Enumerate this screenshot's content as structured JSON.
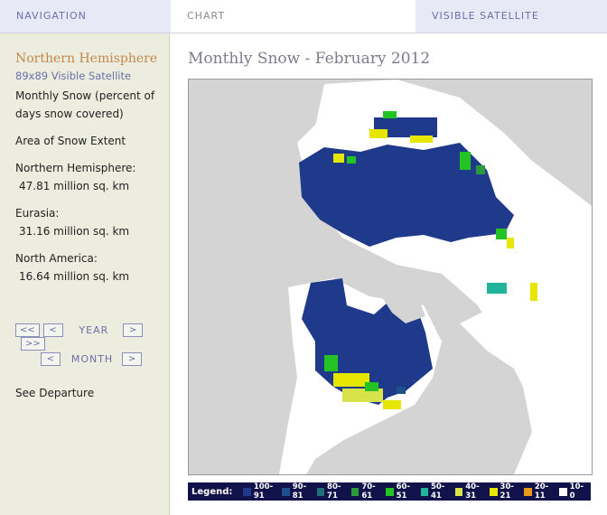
{
  "tabs": {
    "navigation": "NAVIGATION",
    "chart": "CHART",
    "visible_satellite": "VISIBLE SATELLITE"
  },
  "sidebar": {
    "title": "Northern Hemisphere",
    "subtitle": "89x89 Visible Satellite",
    "product": "Monthly Snow (percent of days snow covered)",
    "area_heading": "Area of Snow Extent",
    "nh_label": "Northern Hemisphere:",
    "nh_value": "47.81 million sq. km",
    "eu_label": "Eurasia:",
    "eu_value": "31.16 million sq. km",
    "na_label": "North America:",
    "na_value": "16.64 million sq. km",
    "year_label": "YEAR",
    "month_label": "MONTH",
    "first": "<<",
    "prev": "<",
    "next": ">",
    "last": ">>",
    "see_departure": "See Departure"
  },
  "main": {
    "title": "Monthly Snow - February 2012"
  },
  "legend": {
    "title": "Legend:",
    "items": [
      {
        "label": "100-91",
        "color": "#1f3a8a"
      },
      {
        "label": "90-81",
        "color": "#1e4f8c"
      },
      {
        "label": "80-71",
        "color": "#1f6f78"
      },
      {
        "label": "70-61",
        "color": "#2a9a3a"
      },
      {
        "label": "60-51",
        "color": "#22c322"
      },
      {
        "label": "50-41",
        "color": "#20b49a"
      },
      {
        "label": "40-31",
        "color": "#d8e24a"
      },
      {
        "label": "30-21",
        "color": "#e6e600"
      },
      {
        "label": "20-11",
        "color": "#e89a1a"
      },
      {
        "label": "10-0",
        "color": "#ffffff"
      }
    ]
  },
  "colors": {
    "snow_high": "#1f3a8a",
    "land": "#ffffff",
    "water": "#d4d4d4"
  }
}
